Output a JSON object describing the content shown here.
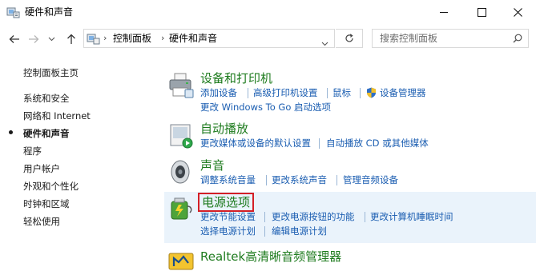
{
  "window": {
    "title": "硬件和声音",
    "controls": [
      "minimize",
      "maximize",
      "close"
    ]
  },
  "address_bar": {
    "crumbs": [
      "控制面板",
      "硬件和声音"
    ],
    "search_placeholder": "搜索控制面板"
  },
  "left_nav": {
    "items": [
      {
        "label": "控制面板主页",
        "current": false
      },
      {
        "label": "系统和安全",
        "current": false
      },
      {
        "label": "网络和 Internet",
        "current": false
      },
      {
        "label": "硬件和声音",
        "current": true
      },
      {
        "label": "程序",
        "current": false
      },
      {
        "label": "用户帐户",
        "current": false
      },
      {
        "label": "外观和个性化",
        "current": false
      },
      {
        "label": "时钟和区域",
        "current": false
      },
      {
        "label": "轻松使用",
        "current": false
      }
    ]
  },
  "categories": [
    {
      "title": "设备和打印机",
      "icon": "printer-icon",
      "rows": [
        [
          "添加设备",
          "高级打印机设置",
          "鼠标",
          "设备管理器"
        ],
        [
          "更改 Windows To Go 启动选项"
        ]
      ]
    },
    {
      "title": "自动播放",
      "icon": "autoplay-icon",
      "rows": [
        [
          "更改媒体或设备的默认设置",
          "自动播放 CD 或其他媒体"
        ]
      ]
    },
    {
      "title": "声音",
      "icon": "speaker-icon",
      "rows": [
        [
          "调整系统音量",
          "更改系统声音",
          "管理音频设备"
        ]
      ]
    },
    {
      "title": "电源选项",
      "icon": "power-options-icon",
      "highlighted": true,
      "rows": [
        [
          "更改节能设置",
          "更改电源按钮的功能",
          "更改计算机睡眠时间"
        ],
        [
          "选择电源计划",
          "编辑电源计划"
        ]
      ]
    },
    {
      "title": "Realtek高清晰音频管理器",
      "icon": "realtek-audio-icon",
      "rows": []
    }
  ],
  "colors": {
    "category_title": "#1e7b1e",
    "link": "#1a5db1",
    "highlight_row": "#eaf3fb",
    "annotation_box": "#d41f26",
    "shield": "#2f6fc5"
  }
}
